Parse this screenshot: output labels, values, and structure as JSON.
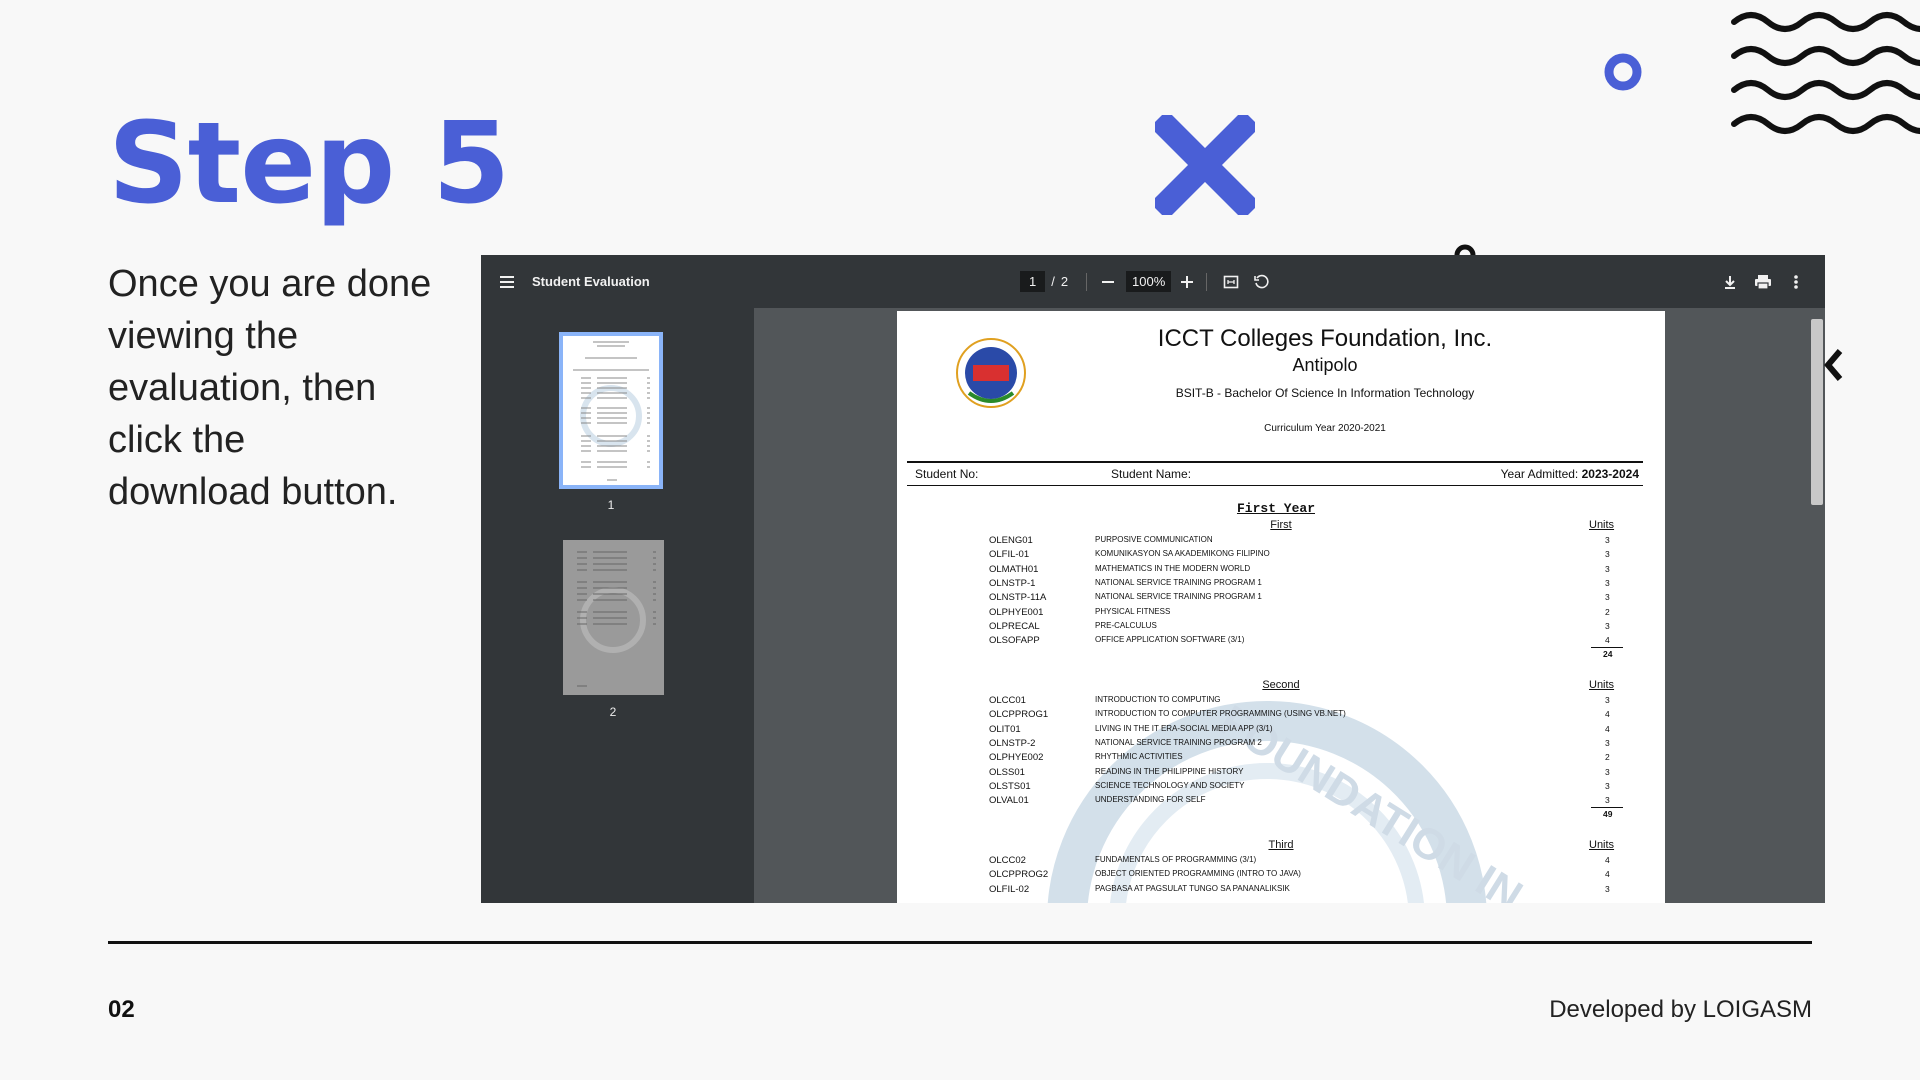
{
  "slide": {
    "title": "Step 5",
    "description_lines": [
      "Once you are done",
      "viewing the",
      "evaluation, then",
      "click the",
      "download button."
    ],
    "page_number": "02",
    "credit": "Developed by LOIGASM"
  },
  "colors": {
    "accent": "#4a5fd6",
    "toolbar": "#323639",
    "viewer_bg": "#525659"
  },
  "viewer": {
    "doc_title": "Student Evaluation",
    "current_page": "1",
    "page_separator": "/",
    "total_pages": "2",
    "zoom": "100%",
    "thumbnail_labels": [
      "1",
      "2"
    ]
  },
  "document": {
    "institution": "ICCT Colleges Foundation, Inc.",
    "campus": "Antipolo",
    "program": "BSIT-B - Bachelor Of Science In Information Technology",
    "curriculum": "Curriculum Year 2020-2021",
    "student_no_label": "Student No:",
    "student_name_label": "Student Name:",
    "year_admitted_label": "Year Admitted:",
    "year_admitted_value": "2023-2024",
    "year_heading": "First Year",
    "units_header": "Units",
    "watermark": "ICCT COLLEGES FOUNDATION INC",
    "terms": [
      {
        "name": "First",
        "total": "24",
        "courses": [
          {
            "code": "OLENG01",
            "title": "PURPOSIVE COMMUNICATION",
            "units": "3"
          },
          {
            "code": "OLFIL-01",
            "title": "KOMUNIKASYON SA AKADEMIKONG FILIPINO",
            "units": "3"
          },
          {
            "code": "OLMATH01",
            "title": "MATHEMATICS IN THE MODERN WORLD",
            "units": "3"
          },
          {
            "code": "OLNSTP-1",
            "title": "NATIONAL SERVICE TRAINING PROGRAM 1",
            "units": "3"
          },
          {
            "code": "OLNSTP-11A",
            "title": "NATIONAL SERVICE TRAINING PROGRAM 1",
            "units": "3"
          },
          {
            "code": "OLPHYE001",
            "title": "PHYSICAL FITNESS",
            "units": "2"
          },
          {
            "code": "OLPRECAL",
            "title": "PRE-CALCULUS",
            "units": "3"
          },
          {
            "code": "OLSOFAPP",
            "title": "OFFICE APPLICATION SOFTWARE (3/1)",
            "units": "4"
          }
        ]
      },
      {
        "name": "Second",
        "total": "49",
        "courses": [
          {
            "code": "OLCC01",
            "title": "INTRODUCTION TO COMPUTING",
            "units": "3"
          },
          {
            "code": "OLCPPROG1",
            "title": "INTRODUCTION TO COMPUTER PROGRAMMING (USING VB.NET)",
            "units": "4"
          },
          {
            "code": "OLIT01",
            "title": "LIVING IN THE IT ERA-SOCIAL MEDIA APP (3/1)",
            "units": "4"
          },
          {
            "code": "OLNSTP-2",
            "title": "NATIONAL SERVICE TRAINING PROGRAM 2",
            "units": "3"
          },
          {
            "code": "OLPHYE002",
            "title": "RHYTHMIC ACTIVITIES",
            "units": "2"
          },
          {
            "code": "OLSS01",
            "title": "READING IN THE PHILIPPINE HISTORY",
            "units": "3"
          },
          {
            "code": "OLSTS01",
            "title": "SCIENCE TECHNOLOGY AND SOCIETY",
            "units": "3"
          },
          {
            "code": "OLVAL01",
            "title": "UNDERSTANDING FOR SELF",
            "units": "3"
          }
        ]
      },
      {
        "name": "Third",
        "total": "",
        "courses": [
          {
            "code": "OLCC02",
            "title": "FUNDAMENTALS OF PROGRAMMING (3/1)",
            "units": "4"
          },
          {
            "code": "OLCPPROG2",
            "title": "OBJECT ORIENTED PROGRAMMING (INTRO TO JAVA)",
            "units": "4"
          },
          {
            "code": "OLFIL-02",
            "title": "PAGBASA AT PAGSULAT TUNGO SA PANANALIKSIK",
            "units": "3"
          }
        ]
      }
    ]
  },
  "icons": [
    "menu-icon",
    "zoom-out-icon",
    "zoom-in-icon",
    "fit-page-icon",
    "rotate-icon",
    "download-icon",
    "print-icon",
    "more-icon"
  ]
}
